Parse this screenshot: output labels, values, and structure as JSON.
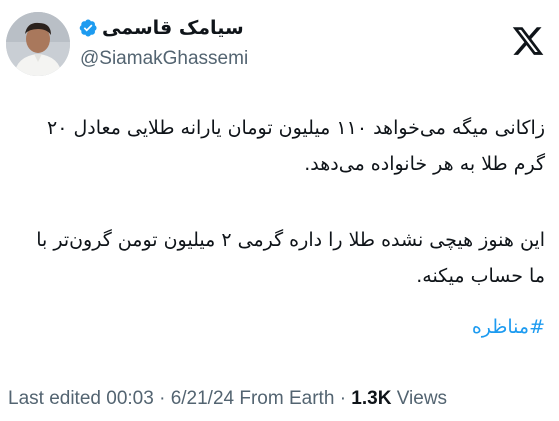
{
  "author": {
    "display_name": "سیامک قاسمی",
    "handle": "@SiamakGhassemi",
    "verified": true,
    "verified_color": "#1d9bf0",
    "avatar_icon": "user-photo"
  },
  "brand": {
    "logo_icon": "x-logo-icon",
    "logo_color": "#0f1419"
  },
  "tweet": {
    "paragraph_1": "زاکانی میگه می‌خواهد ۱۱۰ میلیون تومان یارانه طلایی معادل ۲۰ گرم طلا به هر خانواده می‌دهد.",
    "paragraph_2": "این هنوز هیچی نشده طلا را داره گرمی ۲ میلیون تومن گرون‌تر با ما حساب میکنه.",
    "hashtag": "#مناظره",
    "hashtag_color": "#1d9bf0"
  },
  "meta": {
    "edited_label": "Last edited",
    "time": "00:03",
    "separator": "·",
    "date": "6/21/24",
    "source": "From Earth",
    "views_count": "1.3K",
    "views_label": "Views",
    "meta_color": "#536471"
  }
}
